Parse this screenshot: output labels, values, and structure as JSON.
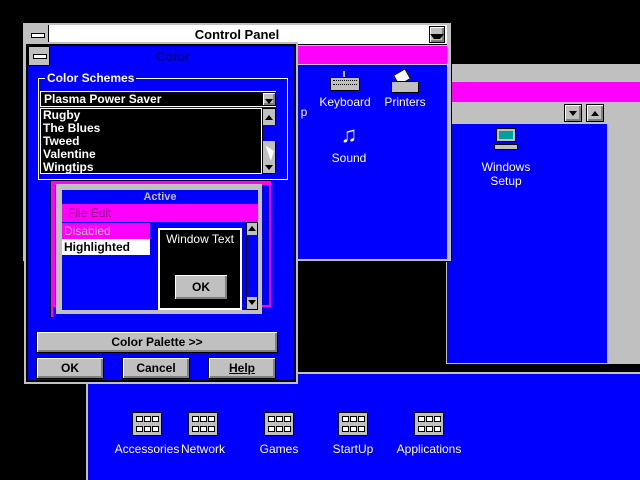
{
  "control_panel": {
    "title": "Control Panel",
    "icons": [
      {
        "label": "Keyboard",
        "icon": "keyboard-icon"
      },
      {
        "label": "Printers",
        "icon": "printer-icon"
      },
      {
        "label": "Sound",
        "icon": "sound-icon"
      },
      {
        "label": "p",
        "icon": "partial-icon"
      }
    ]
  },
  "second_window": {
    "icons": [
      {
        "label": "Windows Setup",
        "icon": "windows-setup-icon"
      }
    ]
  },
  "group_window": {
    "icons": [
      {
        "label": "Accessories",
        "icon": "program-group-icon"
      },
      {
        "label": "Network",
        "icon": "program-group-icon"
      },
      {
        "label": "Games",
        "icon": "program-group-icon"
      },
      {
        "label": "StartUp",
        "icon": "program-group-icon"
      },
      {
        "label": "Applications",
        "icon": "program-group-icon"
      }
    ]
  },
  "color_dialog": {
    "title": "Color",
    "schemes_label": "Color Schemes",
    "selected_scheme": "Plasma Power Saver",
    "scheme_list": [
      "Rugby",
      "The Blues",
      "Tweed",
      "Valentine",
      "Wingtips"
    ],
    "preview": {
      "active_title": "Active",
      "menu": "File  Edit",
      "disabled": "Disabled",
      "highlighted": "Highlighted",
      "window_text": "Window Text",
      "ok": "OK"
    },
    "buttons": {
      "palette": "Color Palette >>",
      "ok": "OK",
      "cancel": "Cancel",
      "help": "Help"
    }
  },
  "colors": {
    "desktop": "#000000",
    "window": "#0000ff",
    "menubar": "#ff00ff",
    "face": "#c0c0c0"
  }
}
